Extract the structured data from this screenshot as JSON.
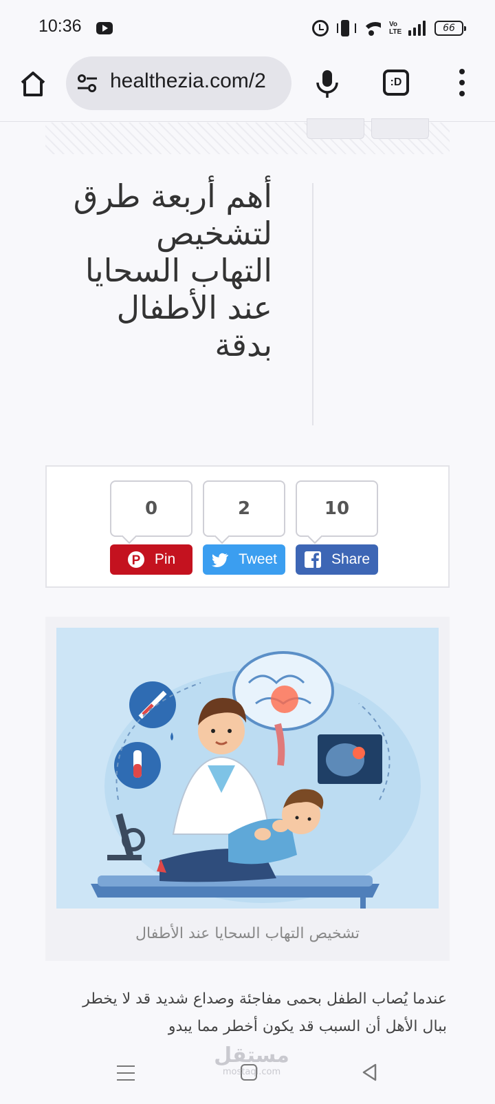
{
  "status_bar": {
    "time": "10:36",
    "battery": "66",
    "volte": "Vo\nLTE",
    "icons": [
      "youtube-icon",
      "alarm-icon",
      "vibrate-icon",
      "wifi-icon",
      "volte-icon",
      "signal-icon",
      "battery-icon"
    ]
  },
  "browser": {
    "url": "healthezia.com/2",
    "tabs_label": ":D",
    "icons": [
      "home-icon",
      "site-settings-icon",
      "mic-icon",
      "tabs-icon",
      "more-menu-icon"
    ]
  },
  "article": {
    "title": "أهم أربعة طرق لتشخيص التهاب السحايا عند الأطفال بدقة",
    "image_caption": "تشخيص التهاب السحايا عند الأطفال",
    "body_intro": "عندما يُصاب الطفل بحمى مفاجئة وصداع شديد قد لا يخطر ببال الأهل أن السبب قد يكون أخطر مما يبدو"
  },
  "share": {
    "pinterest": {
      "count": "0",
      "label": "Pin",
      "color": "#c4121f"
    },
    "twitter": {
      "count": "2",
      "label": "Tweet",
      "color": "#3b9ef0"
    },
    "facebook": {
      "count": "10",
      "label": "Share",
      "color": "#3d66b5"
    }
  },
  "watermark": {
    "text": "مستقل",
    "sub": "mostaql.com"
  },
  "navbar": {
    "icons": [
      "recents-icon",
      "home-nav-icon",
      "back-icon"
    ]
  }
}
